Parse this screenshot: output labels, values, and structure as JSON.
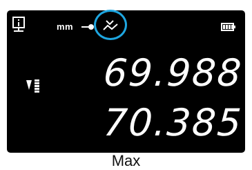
{
  "status_bar": {
    "unit": "mm",
    "icons": [
      "info-icon",
      "probe-icon",
      "mode-max-icon",
      "battery-icon"
    ],
    "highlight_color": "#1ea6e0"
  },
  "display": {
    "indicator_icon": "trend-arrow-bar-icon",
    "primary_value": "69.988",
    "secondary_value": "70.385"
  },
  "caption": "Max",
  "colors": {
    "screen_bg": "#000000",
    "text": "#ffffff",
    "accent": "#1ea6e0"
  }
}
